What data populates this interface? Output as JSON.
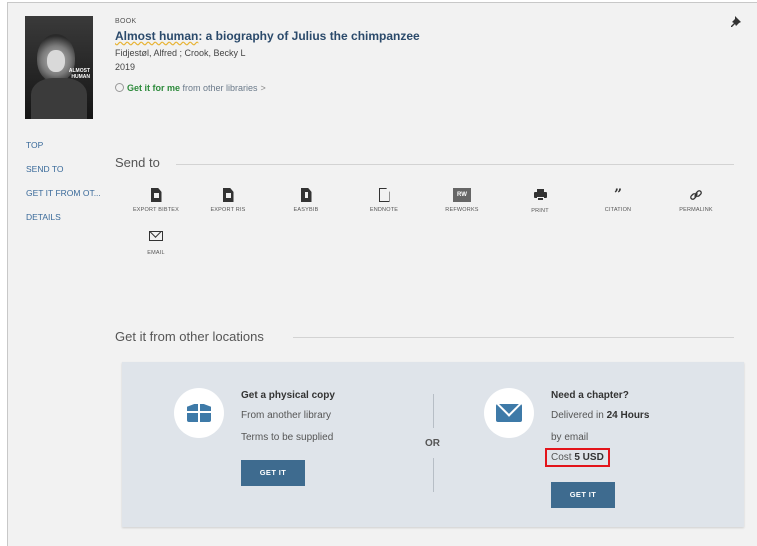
{
  "record": {
    "type": "BOOK",
    "title_first": "Almost human",
    "title_rest": ": a biography of Julius the chimpanzee",
    "authors": "Fidjestøl, Alfred ; Crook, Becky L",
    "year": "2019",
    "get_it_strong": "Get it for me",
    "get_it_rest": " from other libraries",
    "get_it_chevron": ">",
    "cover_text": "ALMOST HUMAN"
  },
  "nav": {
    "items": [
      "TOP",
      "SEND TO",
      "GET IT FROM OT...",
      "DETAILS"
    ]
  },
  "send_to": {
    "title": "Send to",
    "items": [
      {
        "label": "EXPORT BIBTEX",
        "icon": "export-bibtex-icon"
      },
      {
        "label": "EXPORT RIS",
        "icon": "export-ris-icon"
      },
      {
        "label": "EASYBIB",
        "icon": "easybib-icon"
      },
      {
        "label": "ENDNOTE",
        "icon": "endnote-icon"
      },
      {
        "label": "REFWORKS",
        "icon": "refworks-icon",
        "badge": "RW"
      },
      {
        "label": "PRINT",
        "icon": "print-icon"
      },
      {
        "label": "CITATION",
        "icon": "citation-icon",
        "glyph": "❞"
      },
      {
        "label": "PERMALINK",
        "icon": "permalink-icon",
        "glyph": "🔗"
      },
      {
        "label": "EMAIL",
        "icon": "email-icon"
      }
    ]
  },
  "get_it": {
    "title": "Get it from other locations",
    "physical": {
      "title": "Get a physical copy",
      "line1": "From another library",
      "line2": "Terms to be supplied",
      "button": "GET IT"
    },
    "or": "OR",
    "chapter": {
      "title": "Need a chapter?",
      "delivered_prefix": "Delivered in ",
      "delivered_bold": "24 Hours",
      "line2": "by email",
      "cost_prefix": "Cost ",
      "cost_bold": "5 USD",
      "button": "GET IT"
    }
  },
  "colors": {
    "accent": "#3e6b8f",
    "link_green": "#2d8a3b",
    "highlight": "#e3141b"
  }
}
